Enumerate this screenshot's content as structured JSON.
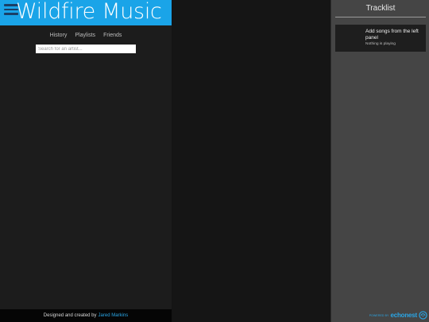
{
  "header": {
    "title": "Wildfire Music",
    "menu_icon": "hamburger-menu-icon"
  },
  "nav": {
    "items": [
      {
        "label": "History"
      },
      {
        "label": "Playlists"
      },
      {
        "label": "Friends"
      }
    ]
  },
  "search": {
    "placeholder": "Search for an artist..."
  },
  "footer": {
    "text": "Designed and created by",
    "author": "Jared Markins"
  },
  "tracklist": {
    "title": "Tracklist",
    "now_playing_title": "Add songs from the left panel",
    "now_playing_status": "Nothing is playing"
  },
  "powered": {
    "label": "POWERED BY",
    "brand": "echonest",
    "icon": "echonest-logo-icon"
  },
  "colors": {
    "accent": "#1aa4e8",
    "link": "#2aa6e6",
    "left_bg": "#1c1c1c",
    "center_bg": "#151515",
    "right_bg": "#454545"
  }
}
